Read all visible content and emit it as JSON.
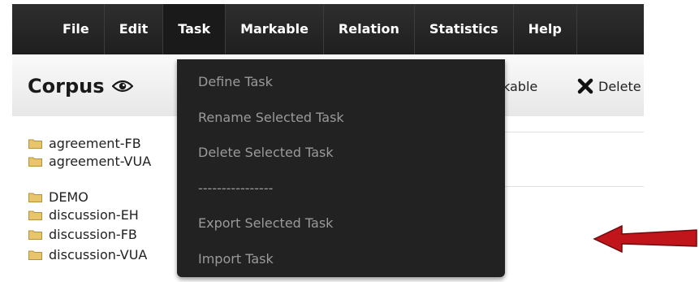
{
  "menubar": {
    "items": [
      {
        "label": "File"
      },
      {
        "label": "Edit"
      },
      {
        "label": "Task"
      },
      {
        "label": "Markable"
      },
      {
        "label": "Relation"
      },
      {
        "label": "Statistics"
      },
      {
        "label": "Help"
      }
    ]
  },
  "toolbar": {
    "title": "Corpus",
    "title_icon": "eye-icon",
    "markable_label": "kable",
    "delete_icon": "close-icon",
    "delete_label": "Delete"
  },
  "tree": {
    "items": [
      {
        "label": "agreement-FB",
        "icon": "folder-icon"
      },
      {
        "label": "agreement-VUA",
        "icon": "folder-icon"
      },
      {
        "label": "DEMO",
        "icon": "folder-icon"
      },
      {
        "label": "discussion-EH",
        "icon": "folder-icon"
      },
      {
        "label": "discussion-FB",
        "icon": "folder-icon"
      },
      {
        "label": "discussion-VUA",
        "icon": "folder-icon"
      }
    ]
  },
  "task_menu": {
    "items": [
      {
        "label": "Define Task"
      },
      {
        "label": "Rename Selected Task"
      },
      {
        "label": "Delete Selected Task"
      },
      {
        "label": "----------------"
      },
      {
        "label": "Export Selected Task"
      },
      {
        "label": "Import Task"
      }
    ]
  },
  "annotation": {
    "arrow_icon": "red-arrow-icon",
    "arrow_color": "#c0161b"
  },
  "colors": {
    "menubar_bg": "#222222",
    "menu_text": "#ffffff",
    "dropdown_text": "#9a9a9a",
    "folder": "#e8c56a"
  }
}
